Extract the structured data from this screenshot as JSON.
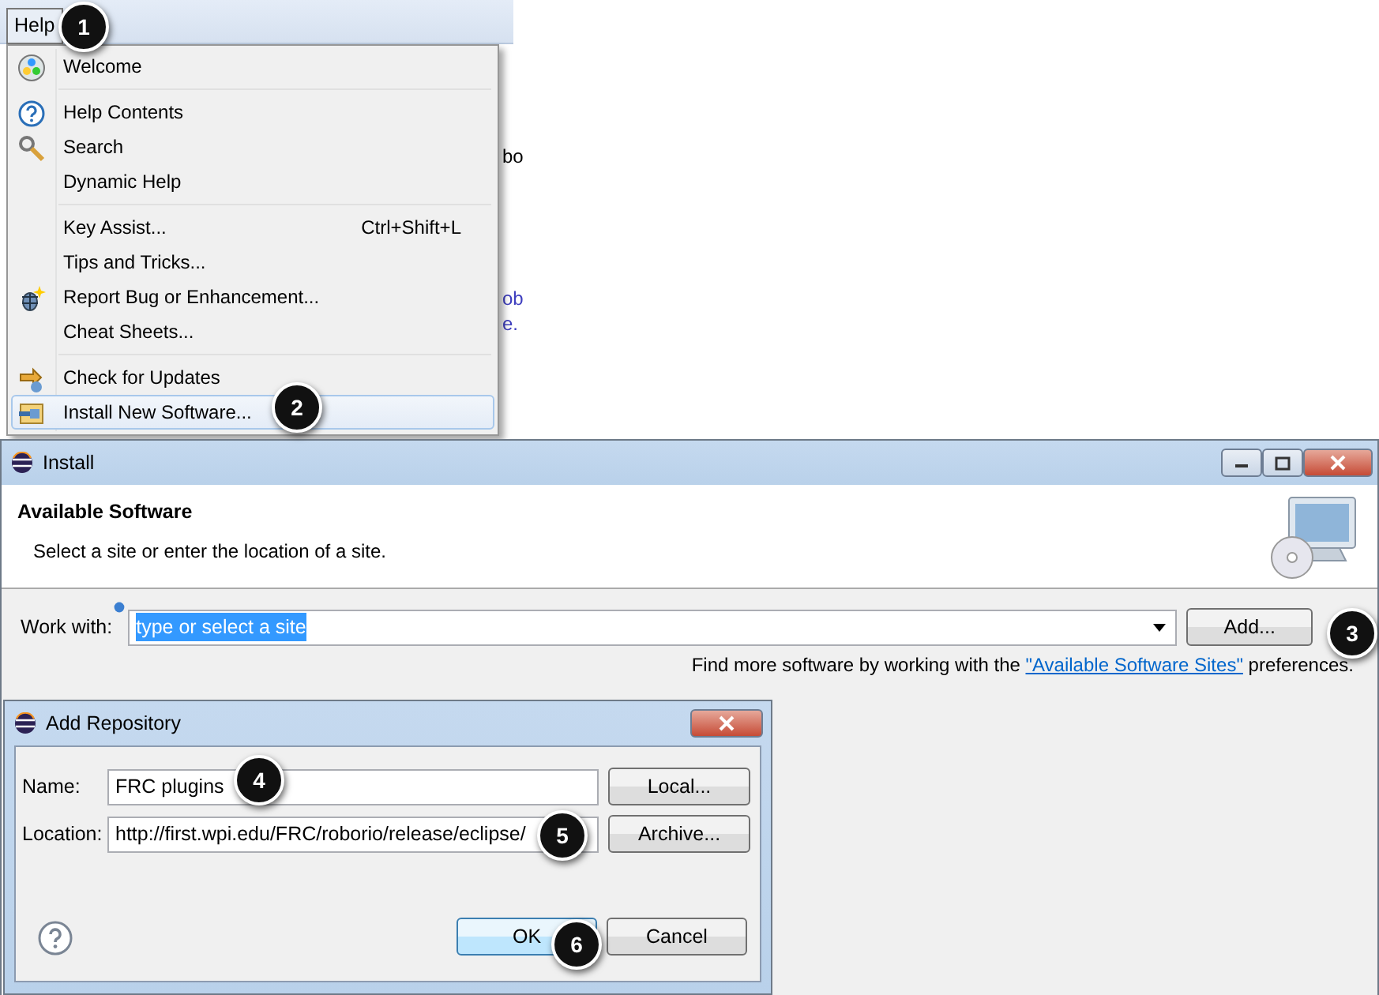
{
  "menu_bar": {
    "menu": "Help"
  },
  "editor": {
    "fragments": [
      "bo",
      "ob",
      "e."
    ]
  },
  "help_menu": {
    "groups": [
      [
        {
          "label": "Welcome",
          "selected": false
        }
      ],
      [
        {
          "label": "Help Contents",
          "selected": false
        },
        {
          "label": "Search",
          "selected": false
        },
        {
          "label": "Dynamic Help",
          "selected": false
        }
      ],
      [
        {
          "label": "Key Assist...",
          "shortcut": "Ctrl+Shift+L",
          "selected": false
        },
        {
          "label": "Tips and Tricks...",
          "selected": false
        },
        {
          "label": "Report Bug or Enhancement...",
          "selected": false
        },
        {
          "label": "Cheat Sheets...",
          "selected": false
        }
      ],
      [
        {
          "label": "Check for Updates",
          "selected": false
        },
        {
          "label": "Install New Software...",
          "selected": true
        }
      ]
    ]
  },
  "install_window": {
    "title": "Install",
    "header_title": "Available Software",
    "header_subtitle": "Select a site or enter the location of a site.",
    "work_with_label": "Work with:",
    "work_with_value": "type or select a site",
    "add_button": "Add...",
    "more_text_before": "Find more software by working with the",
    "more_link": "\"Available Software Sites\"",
    "more_text_after": "preferences."
  },
  "add_repository": {
    "title": "Add Repository",
    "name_label": "Name:",
    "name_value": "FRC plugins",
    "location_label": "Location:",
    "location_value": "http://first.wpi.edu/FRC/roborio/release/eclipse/",
    "local_button": "Local...",
    "archive_button": "Archive...",
    "ok_button": "OK",
    "cancel_button": "Cancel"
  },
  "callouts": [
    "1",
    "2",
    "3",
    "4",
    "5",
    "6"
  ]
}
